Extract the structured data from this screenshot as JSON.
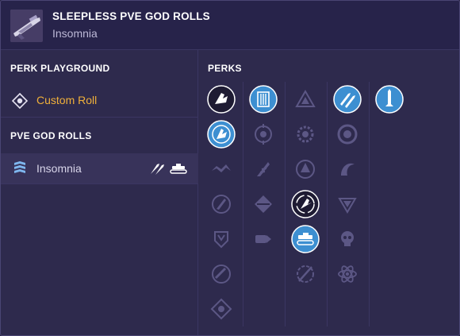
{
  "header": {
    "title": "SLEEPLESS PVE GOD ROLLS",
    "subtitle": "Insomnia"
  },
  "left": {
    "perk_playground_heading": "PERK PLAYGROUND",
    "custom_roll_label": "Custom Roll",
    "pve_god_rolls_heading": "PVE GOD ROLLS",
    "rolls": [
      {
        "label": "Insomnia"
      }
    ]
  },
  "perks_panel": {
    "heading": "PERKS",
    "columns": [
      [
        {
          "icon": "barrel-icon",
          "state": "owned"
        },
        {
          "icon": "barrel-alt-icon",
          "state": "selected"
        },
        {
          "icon": "ridge-icon",
          "state": "inactive"
        },
        {
          "icon": "hammer-forged-icon",
          "state": "inactive"
        },
        {
          "icon": "linear-comp-icon",
          "state": "inactive"
        },
        {
          "icon": "fluted-barrel-icon",
          "state": "inactive"
        },
        {
          "icon": "ridged-chamber-icon",
          "state": "inactive"
        }
      ],
      [
        {
          "icon": "magazine-icon",
          "state": "selected"
        },
        {
          "icon": "crosshair-icon",
          "state": "inactive"
        },
        {
          "icon": "feather-icon",
          "state": "inactive"
        },
        {
          "icon": "diamond-icon",
          "state": "inactive"
        },
        {
          "icon": "bullet-icon",
          "state": "inactive"
        }
      ],
      [
        {
          "icon": "triangle-icon",
          "state": "inactive"
        },
        {
          "icon": "gear-icon",
          "state": "inactive"
        },
        {
          "icon": "reticle-icon",
          "state": "inactive"
        },
        {
          "icon": "auto-loading-icon",
          "state": "owned"
        },
        {
          "icon": "tank-icon",
          "state": "selected"
        },
        {
          "icon": "slash-icon",
          "state": "inactive"
        }
      ],
      [
        {
          "icon": "rockets-icon",
          "state": "selected"
        },
        {
          "icon": "ring-icon",
          "state": "inactive"
        },
        {
          "icon": "wave-icon",
          "state": "inactive"
        },
        {
          "icon": "chevron-icon",
          "state": "inactive"
        },
        {
          "icon": "skull-icon",
          "state": "inactive"
        },
        {
          "icon": "atom-icon",
          "state": "inactive"
        }
      ],
      [
        {
          "icon": "missile-icon",
          "state": "selected"
        }
      ]
    ]
  },
  "colors": {
    "accent_gold": "#f0b03a",
    "selected_blue": "#3d8fd1",
    "background": "#2e2a4d"
  }
}
